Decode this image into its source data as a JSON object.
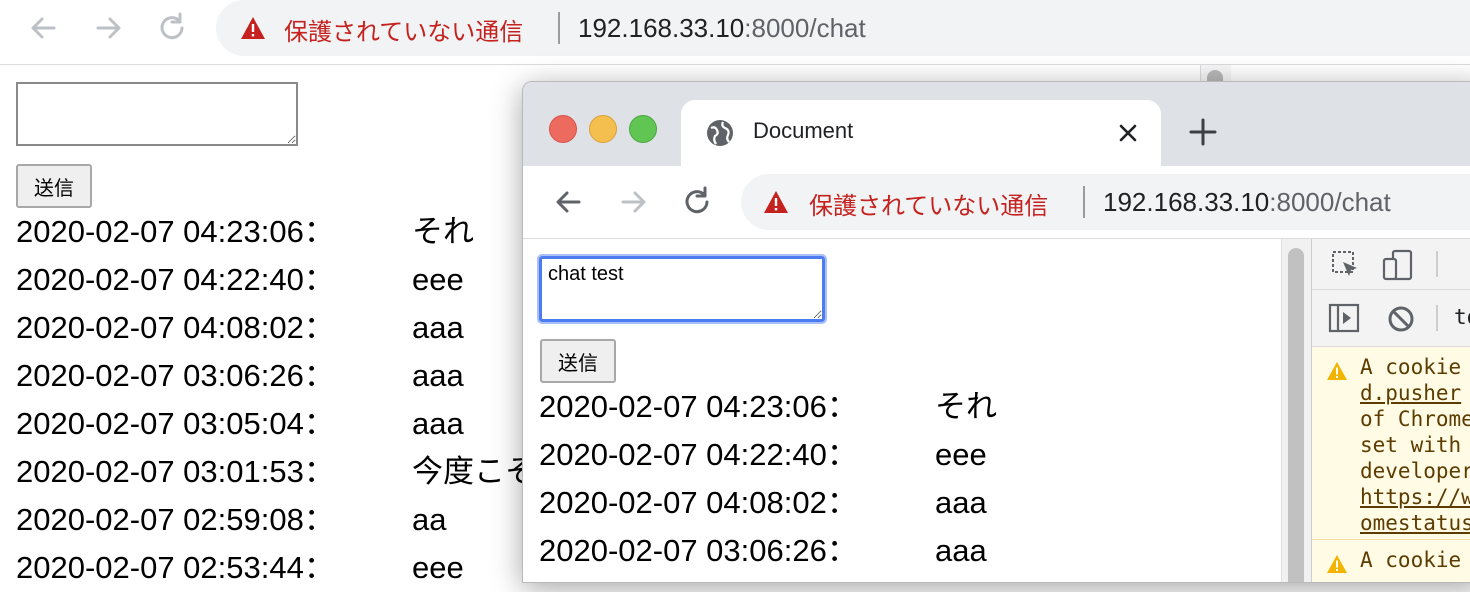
{
  "background_window": {
    "address_bar": {
      "security_label": "保護されていない通信",
      "url_host": "192.168.33.10",
      "url_rest": ":8000/chat"
    },
    "chat_input": {
      "value": ""
    },
    "send_label": "送信",
    "messages": [
      {
        "timestamp": "2020-02-07 04:23:06：",
        "text": "それ"
      },
      {
        "timestamp": "2020-02-07 04:22:40：",
        "text": "eee"
      },
      {
        "timestamp": "2020-02-07 04:08:02：",
        "text": "aaa"
      },
      {
        "timestamp": "2020-02-07 03:06:26：",
        "text": "aaa"
      },
      {
        "timestamp": "2020-02-07 03:05:04：",
        "text": "aaa"
      },
      {
        "timestamp": "2020-02-07 03:01:53：",
        "text": "今度こそ"
      },
      {
        "timestamp": "2020-02-07 02:59:08：",
        "text": "aa"
      },
      {
        "timestamp": "2020-02-07 02:53:44：",
        "text": "eee"
      }
    ]
  },
  "front_window": {
    "tab": {
      "title": "Document"
    },
    "address_bar": {
      "security_label": "保護されていない通信",
      "url_host": "192.168.33.10",
      "url_rest": ":8000/chat"
    },
    "chat_input": {
      "value": "chat test"
    },
    "send_label": "送信",
    "messages": [
      {
        "timestamp": "2020-02-07 04:23:06：",
        "text": "それ"
      },
      {
        "timestamp": "2020-02-07 04:22:40：",
        "text": "eee"
      },
      {
        "timestamp": "2020-02-07 04:08:02：",
        "text": "aaa"
      },
      {
        "timestamp": "2020-02-07 03:06:26：",
        "text": "aaa"
      }
    ],
    "devtools": {
      "filter_text": "to",
      "warning_lines": [
        "A cookie",
        "d.pusher",
        "of Chrome",
        "set with",
        "developer",
        "https://w",
        "omestatus"
      ],
      "warning2_first_line": "A cookie"
    }
  },
  "colors": {
    "insecure_red": "#c5221f",
    "focus_blue": "#4d7cf0",
    "tab_strip": "#dee1e6",
    "traffic_close": "#ed6a5e",
    "traffic_min": "#f5bf4f",
    "traffic_max": "#61c554",
    "devtools_warning_bg": "#fffbe5"
  }
}
